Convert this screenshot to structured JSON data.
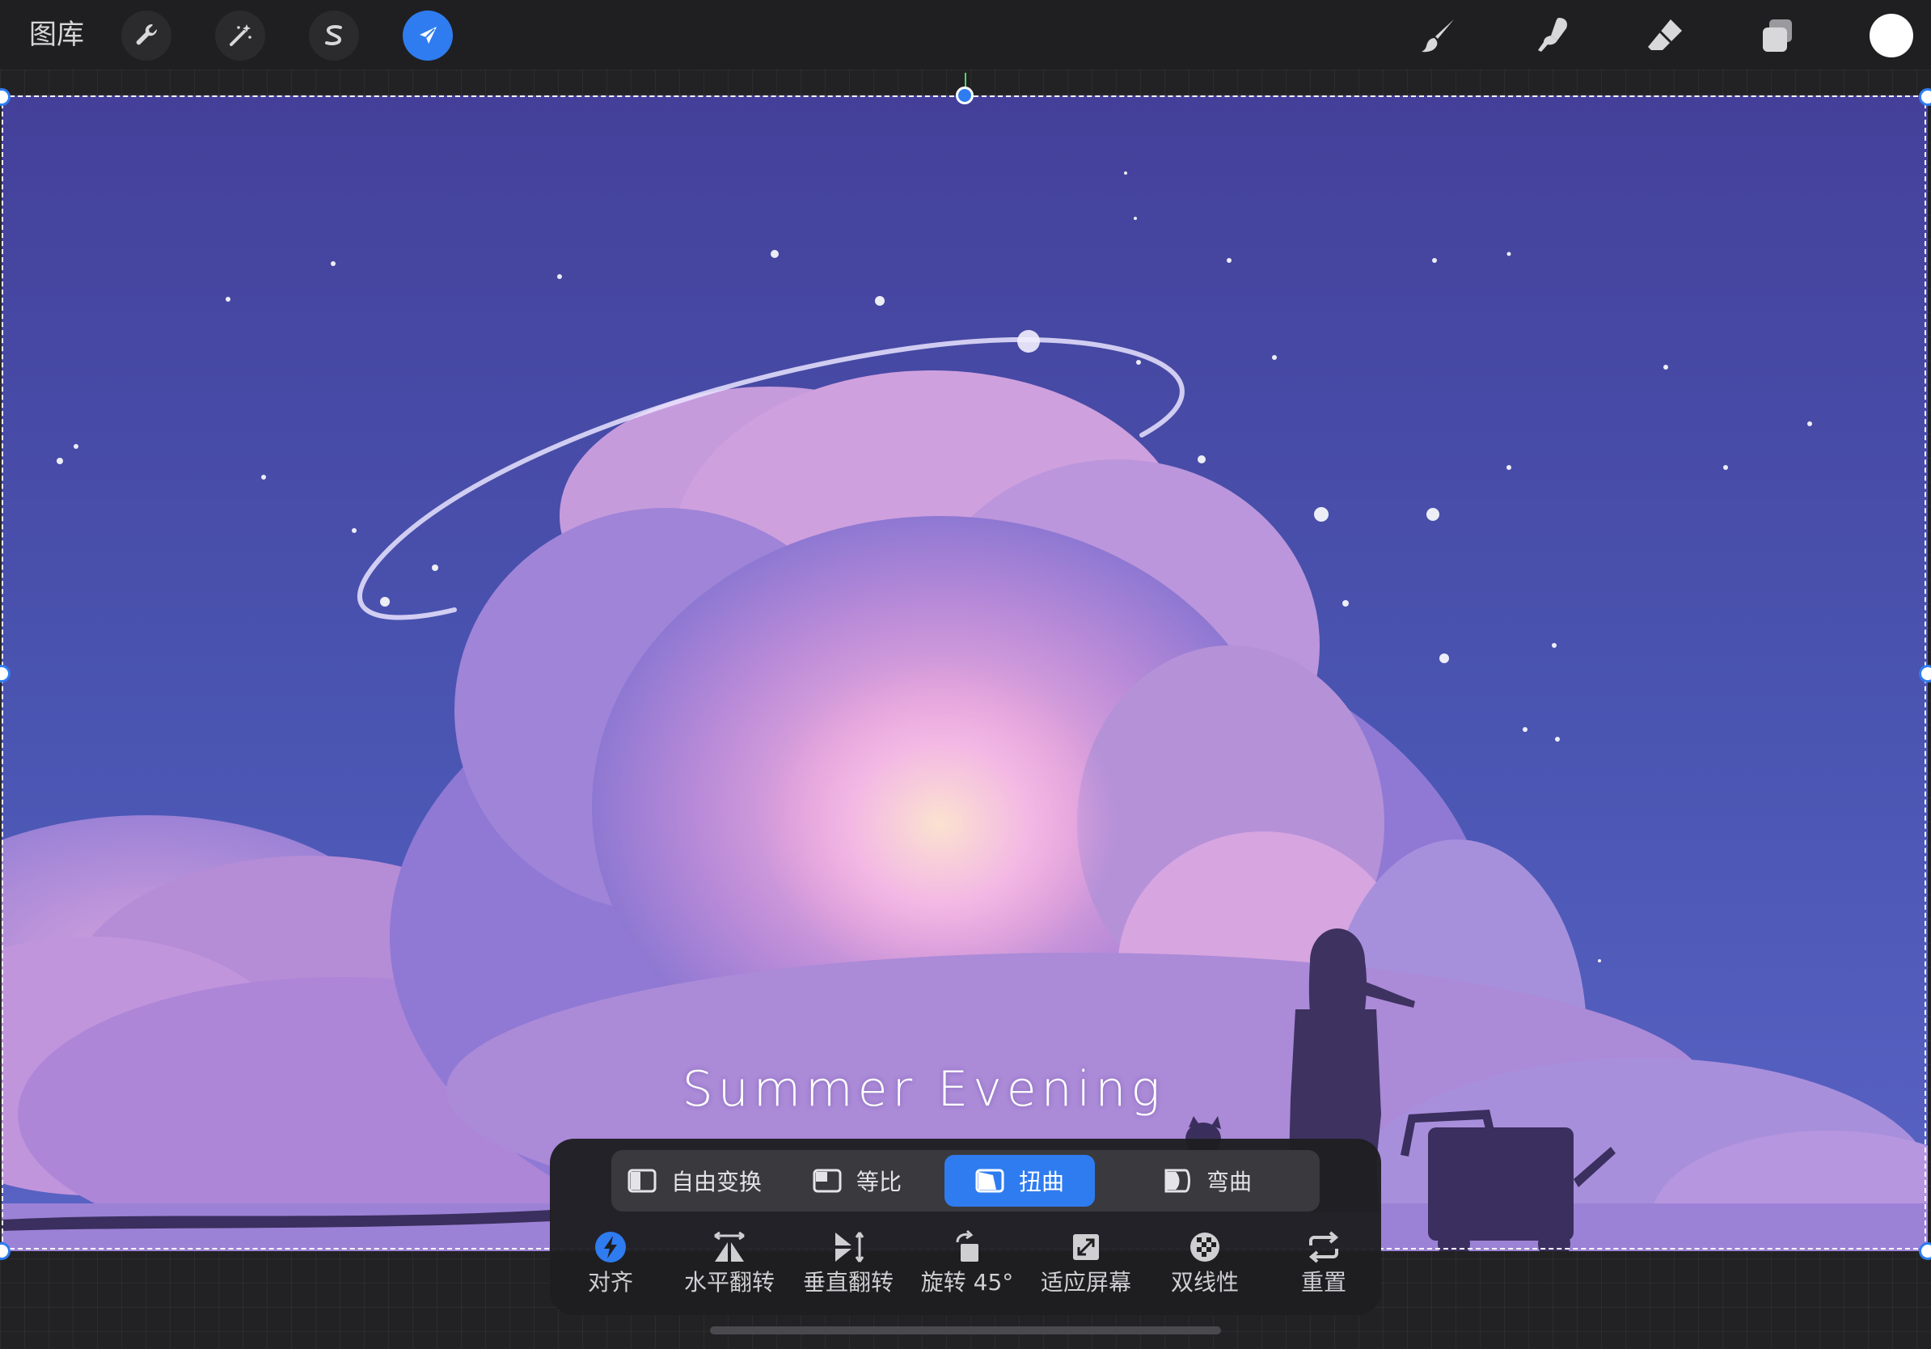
{
  "topbar": {
    "gallery_label": "图库",
    "tools_left": [
      {
        "name": "actions",
        "icon": "wrench-icon"
      },
      {
        "name": "adjustments",
        "icon": "magic-wand-icon"
      },
      {
        "name": "selection",
        "icon": "selection-s-icon"
      },
      {
        "name": "transform",
        "icon": "arrow-cursor-icon",
        "active": true
      }
    ],
    "tools_right": [
      {
        "name": "brush",
        "icon": "brush-icon"
      },
      {
        "name": "smudge",
        "icon": "smudge-finger-icon"
      },
      {
        "name": "eraser",
        "icon": "eraser-icon"
      },
      {
        "name": "layers",
        "icon": "layers-icon"
      }
    ],
    "current_color": "#ffffff"
  },
  "canvas": {
    "artwork_title": "Summer Evening",
    "accent": "#2f7cf0"
  },
  "transform": {
    "modes": [
      {
        "label": "自由变换",
        "active": false
      },
      {
        "label": "等比",
        "active": false
      },
      {
        "label": "扭曲",
        "active": true
      },
      {
        "label": "弯曲",
        "active": false
      }
    ],
    "actions": [
      {
        "label": "对齐",
        "icon": "snap-lightning-icon"
      },
      {
        "label": "水平翻转",
        "icon": "flip-horizontal-icon"
      },
      {
        "label": "垂直翻转",
        "icon": "flip-vertical-icon"
      },
      {
        "label": "旋转 45°",
        "icon": "rotate-icon"
      },
      {
        "label": "适应屏幕",
        "icon": "fit-screen-icon"
      },
      {
        "label": "双线性",
        "icon": "bilinear-icon"
      },
      {
        "label": "重置",
        "icon": "reset-icon"
      }
    ]
  }
}
